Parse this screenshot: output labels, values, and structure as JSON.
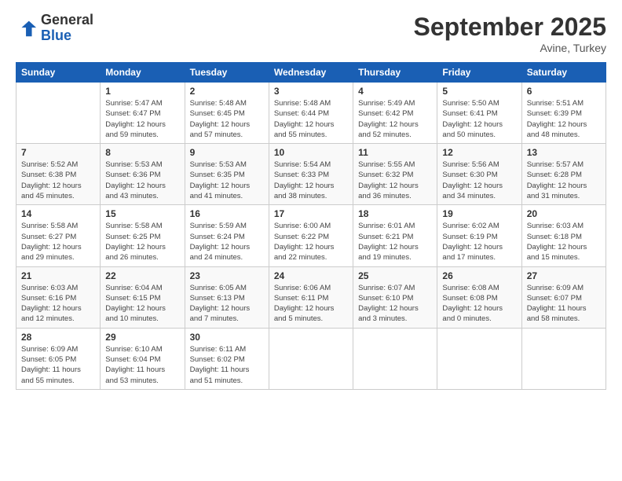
{
  "logo": {
    "line1": "General",
    "line2": "Blue"
  },
  "title": "September 2025",
  "subtitle": "Avine, Turkey",
  "days_header": [
    "Sunday",
    "Monday",
    "Tuesday",
    "Wednesday",
    "Thursday",
    "Friday",
    "Saturday"
  ],
  "weeks": [
    [
      {
        "num": "",
        "info": ""
      },
      {
        "num": "1",
        "info": "Sunrise: 5:47 AM\nSunset: 6:47 PM\nDaylight: 12 hours\nand 59 minutes."
      },
      {
        "num": "2",
        "info": "Sunrise: 5:48 AM\nSunset: 6:45 PM\nDaylight: 12 hours\nand 57 minutes."
      },
      {
        "num": "3",
        "info": "Sunrise: 5:48 AM\nSunset: 6:44 PM\nDaylight: 12 hours\nand 55 minutes."
      },
      {
        "num": "4",
        "info": "Sunrise: 5:49 AM\nSunset: 6:42 PM\nDaylight: 12 hours\nand 52 minutes."
      },
      {
        "num": "5",
        "info": "Sunrise: 5:50 AM\nSunset: 6:41 PM\nDaylight: 12 hours\nand 50 minutes."
      },
      {
        "num": "6",
        "info": "Sunrise: 5:51 AM\nSunset: 6:39 PM\nDaylight: 12 hours\nand 48 minutes."
      }
    ],
    [
      {
        "num": "7",
        "info": "Sunrise: 5:52 AM\nSunset: 6:38 PM\nDaylight: 12 hours\nand 45 minutes."
      },
      {
        "num": "8",
        "info": "Sunrise: 5:53 AM\nSunset: 6:36 PM\nDaylight: 12 hours\nand 43 minutes."
      },
      {
        "num": "9",
        "info": "Sunrise: 5:53 AM\nSunset: 6:35 PM\nDaylight: 12 hours\nand 41 minutes."
      },
      {
        "num": "10",
        "info": "Sunrise: 5:54 AM\nSunset: 6:33 PM\nDaylight: 12 hours\nand 38 minutes."
      },
      {
        "num": "11",
        "info": "Sunrise: 5:55 AM\nSunset: 6:32 PM\nDaylight: 12 hours\nand 36 minutes."
      },
      {
        "num": "12",
        "info": "Sunrise: 5:56 AM\nSunset: 6:30 PM\nDaylight: 12 hours\nand 34 minutes."
      },
      {
        "num": "13",
        "info": "Sunrise: 5:57 AM\nSunset: 6:28 PM\nDaylight: 12 hours\nand 31 minutes."
      }
    ],
    [
      {
        "num": "14",
        "info": "Sunrise: 5:58 AM\nSunset: 6:27 PM\nDaylight: 12 hours\nand 29 minutes."
      },
      {
        "num": "15",
        "info": "Sunrise: 5:58 AM\nSunset: 6:25 PM\nDaylight: 12 hours\nand 26 minutes."
      },
      {
        "num": "16",
        "info": "Sunrise: 5:59 AM\nSunset: 6:24 PM\nDaylight: 12 hours\nand 24 minutes."
      },
      {
        "num": "17",
        "info": "Sunrise: 6:00 AM\nSunset: 6:22 PM\nDaylight: 12 hours\nand 22 minutes."
      },
      {
        "num": "18",
        "info": "Sunrise: 6:01 AM\nSunset: 6:21 PM\nDaylight: 12 hours\nand 19 minutes."
      },
      {
        "num": "19",
        "info": "Sunrise: 6:02 AM\nSunset: 6:19 PM\nDaylight: 12 hours\nand 17 minutes."
      },
      {
        "num": "20",
        "info": "Sunrise: 6:03 AM\nSunset: 6:18 PM\nDaylight: 12 hours\nand 15 minutes."
      }
    ],
    [
      {
        "num": "21",
        "info": "Sunrise: 6:03 AM\nSunset: 6:16 PM\nDaylight: 12 hours\nand 12 minutes."
      },
      {
        "num": "22",
        "info": "Sunrise: 6:04 AM\nSunset: 6:15 PM\nDaylight: 12 hours\nand 10 minutes."
      },
      {
        "num": "23",
        "info": "Sunrise: 6:05 AM\nSunset: 6:13 PM\nDaylight: 12 hours\nand 7 minutes."
      },
      {
        "num": "24",
        "info": "Sunrise: 6:06 AM\nSunset: 6:11 PM\nDaylight: 12 hours\nand 5 minutes."
      },
      {
        "num": "25",
        "info": "Sunrise: 6:07 AM\nSunset: 6:10 PM\nDaylight: 12 hours\nand 3 minutes."
      },
      {
        "num": "26",
        "info": "Sunrise: 6:08 AM\nSunset: 6:08 PM\nDaylight: 12 hours\nand 0 minutes."
      },
      {
        "num": "27",
        "info": "Sunrise: 6:09 AM\nSunset: 6:07 PM\nDaylight: 11 hours\nand 58 minutes."
      }
    ],
    [
      {
        "num": "28",
        "info": "Sunrise: 6:09 AM\nSunset: 6:05 PM\nDaylight: 11 hours\nand 55 minutes."
      },
      {
        "num": "29",
        "info": "Sunrise: 6:10 AM\nSunset: 6:04 PM\nDaylight: 11 hours\nand 53 minutes."
      },
      {
        "num": "30",
        "info": "Sunrise: 6:11 AM\nSunset: 6:02 PM\nDaylight: 11 hours\nand 51 minutes."
      },
      {
        "num": "",
        "info": ""
      },
      {
        "num": "",
        "info": ""
      },
      {
        "num": "",
        "info": ""
      },
      {
        "num": "",
        "info": ""
      }
    ]
  ]
}
